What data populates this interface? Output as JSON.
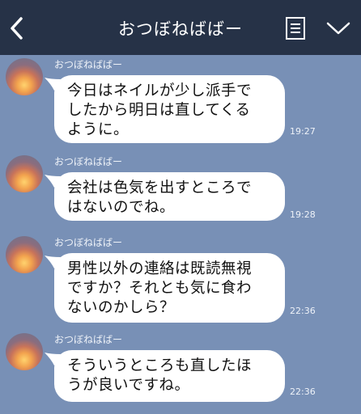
{
  "header": {
    "title": "おつぼねばばー"
  },
  "messages": [
    {
      "sender": "おつぼねばばー",
      "lines": [
        "今日はネイルが少し派手で",
        "したから明日は直してくる",
        "ように。"
      ],
      "time": "19:27"
    },
    {
      "sender": "おつぼねばばー",
      "lines": [
        "会社は色気を出すところで",
        "はないのでね。"
      ],
      "time": "19:28"
    },
    {
      "sender": "おつぼねばばー",
      "lines": [
        "男性以外の連絡は既読無視",
        "ですか？それとも気に食わ",
        "ないのかしら？"
      ],
      "time": "22:36"
    },
    {
      "sender": "おつぼねばばー",
      "lines": [
        "そういうところも直したほ",
        "うが良いですね。"
      ],
      "time": "22:36"
    }
  ],
  "colors": {
    "background": "#7890b6",
    "header": "#263247",
    "bubble": "#ffffff"
  }
}
